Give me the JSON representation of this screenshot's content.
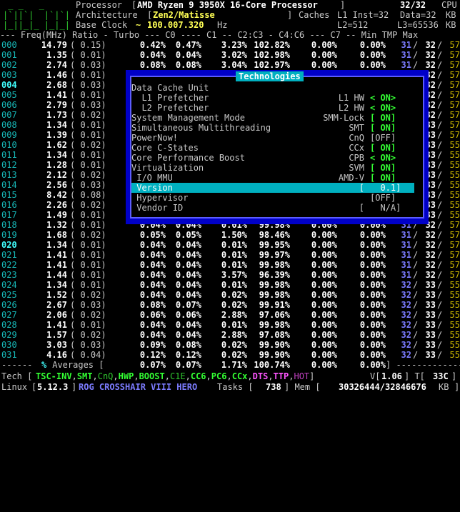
{
  "header": {
    "processor_label": "Processor",
    "processor_name": "AMD Ryzen 9 3950X 16-Core Processor",
    "cpu_count": "32/32",
    "cpu_suffix": "CPU",
    "architecture_label": "Architecture",
    "architecture_name": "Zen2/Matisse",
    "caches_label": "Caches",
    "l1_inst": "L1 Inst=32",
    "l1_data": "Data=32",
    "kb": "KB",
    "base_clock_label": "Base Clock",
    "base_clock_value": "100.007.320",
    "hz": "Hz",
    "l2": "L2=512",
    "l3": "L3=65536",
    "meter_line1": " _ _   _",
    "meter_line2": "|`||`|  |`|`|",
    "meter_line3": "|_||_|_ |_|_|"
  },
  "columns_header": "--- Freq(MHz) Ratio - Turbo --- C0 ---- C1 -- C2:C3 - C4:C6 --- C7 -- Min TMP Max",
  "rows": [
    {
      "cpu": "000",
      "freq": "14.79",
      "ratio": "( 0.15)",
      "turbo": "0.42%",
      "c0": "0.47%",
      "c1": "3.23%",
      "c3": "102.82%",
      "c6": "0.00%",
      "c7": "0.00%",
      "tmin": "31",
      "tcur": "32",
      "tmax": "57"
    },
    {
      "cpu": "001",
      "freq": "1.35",
      "ratio": "( 0.01)",
      "turbo": "0.04%",
      "c0": "0.04%",
      "c1": "3.02%",
      "c3": "102.98%",
      "c6": "0.00%",
      "c7": "0.00%",
      "tmin": "31",
      "tcur": "32",
      "tmax": "57"
    },
    {
      "cpu": "002",
      "freq": "2.74",
      "ratio": "( 0.03)",
      "turbo": "0.08%",
      "c0": "0.08%",
      "c1": "3.04%",
      "c3": "102.97%",
      "c6": "0.00%",
      "c7": "0.00%",
      "tmin": "31",
      "tcur": "32",
      "tmax": "57"
    },
    {
      "cpu": "003",
      "freq": "1.46",
      "ratio": "( 0.01)",
      "turbo": "",
      "c0": "",
      "c1": "",
      "c3": "",
      "c6": "",
      "c7": "",
      "tmin": "",
      "tcur": "32",
      "tmax": "57"
    },
    {
      "cpu": "004",
      "freq": "2.68",
      "ratio": "( 0.03)",
      "turbo": "",
      "c0": "",
      "c1": "",
      "c3": "",
      "c6": "",
      "c7": "",
      "tmin": "",
      "tcur": "32",
      "tmax": "57"
    },
    {
      "cpu": "005",
      "freq": "1.41",
      "ratio": "( 0.01)",
      "turbo": "",
      "c0": "",
      "c1": "",
      "c3": "",
      "c6": "",
      "c7": "",
      "tmin": "",
      "tcur": "32",
      "tmax": "57"
    },
    {
      "cpu": "006",
      "freq": "2.79",
      "ratio": "( 0.03)",
      "turbo": "",
      "c0": "",
      "c1": "",
      "c3": "",
      "c6": "",
      "c7": "",
      "tmin": "",
      "tcur": "32",
      "tmax": "57"
    },
    {
      "cpu": "007",
      "freq": "1.73",
      "ratio": "( 0.02)",
      "turbo": "",
      "c0": "",
      "c1": "",
      "c3": "",
      "c6": "",
      "c7": "",
      "tmin": "",
      "tcur": "32",
      "tmax": "57"
    },
    {
      "cpu": "008",
      "freq": "1.34",
      "ratio": "( 0.01)",
      "turbo": "",
      "c0": "",
      "c1": "",
      "c3": "",
      "c6": "",
      "c7": "",
      "tmin": "",
      "tcur": "33",
      "tmax": "57"
    },
    {
      "cpu": "009",
      "freq": "1.39",
      "ratio": "( 0.01)",
      "turbo": "",
      "c0": "",
      "c1": "",
      "c3": "",
      "c6": "",
      "c7": "",
      "tmin": "",
      "tcur": "33",
      "tmax": "57"
    },
    {
      "cpu": "010",
      "freq": "1.62",
      "ratio": "( 0.02)",
      "turbo": "",
      "c0": "",
      "c1": "",
      "c3": "",
      "c6": "",
      "c7": "",
      "tmin": "",
      "tcur": "33",
      "tmax": "55"
    },
    {
      "cpu": "011",
      "freq": "1.34",
      "ratio": "( 0.01)",
      "turbo": "",
      "c0": "",
      "c1": "",
      "c3": "",
      "c6": "",
      "c7": "",
      "tmin": "",
      "tcur": "33",
      "tmax": "55"
    },
    {
      "cpu": "012",
      "freq": "1.28",
      "ratio": "( 0.01)",
      "turbo": "",
      "c0": "",
      "c1": "",
      "c3": "",
      "c6": "",
      "c7": "",
      "tmin": "",
      "tcur": "33",
      "tmax": "55"
    },
    {
      "cpu": "013",
      "freq": "2.12",
      "ratio": "( 0.02)",
      "turbo": "",
      "c0": "",
      "c1": "",
      "c3": "",
      "c6": "",
      "c7": "",
      "tmin": "",
      "tcur": "33",
      "tmax": "55"
    },
    {
      "cpu": "014",
      "freq": "2.56",
      "ratio": "( 0.03)",
      "turbo": "",
      "c0": "",
      "c1": "",
      "c3": "",
      "c6": "",
      "c7": "",
      "tmin": "",
      "tcur": "33",
      "tmax": "55"
    },
    {
      "cpu": "015",
      "freq": "8.42",
      "ratio": "( 0.08)",
      "turbo": "",
      "c0": "",
      "c1": "",
      "c3": "",
      "c6": "",
      "c7": "",
      "tmin": "",
      "tcur": "33",
      "tmax": "55"
    },
    {
      "cpu": "016",
      "freq": "2.26",
      "ratio": "( 0.02)",
      "turbo": "",
      "c0": "",
      "c1": "",
      "c3": "",
      "c6": "",
      "c7": "",
      "tmin": "",
      "tcur": "33",
      "tmax": "55"
    },
    {
      "cpu": "017",
      "freq": "1.49",
      "ratio": "( 0.01)",
      "turbo": "",
      "c0": "",
      "c1": "",
      "c3": "",
      "c6": "",
      "c7": "",
      "tmin": "",
      "tcur": "33",
      "tmax": "55"
    },
    {
      "cpu": "018",
      "freq": "1.32",
      "ratio": "( 0.01)",
      "turbo": "0.04%",
      "c0": "0.04%",
      "c1": "0.01%",
      "c3": "99.98%",
      "c6": "0.00%",
      "c7": "0.00%",
      "tmin": "31",
      "tcur": "32",
      "tmax": "57"
    },
    {
      "cpu": "019",
      "freq": "1.68",
      "ratio": "( 0.02)",
      "turbo": "0.05%",
      "c0": "0.05%",
      "c1": "1.50%",
      "c3": "98.46%",
      "c6": "0.00%",
      "c7": "0.00%",
      "tmin": "31",
      "tcur": "32",
      "tmax": "57"
    },
    {
      "cpu": "020",
      "freq": "1.34",
      "ratio": "( 0.01)",
      "turbo": "0.04%",
      "c0": "0.04%",
      "c1": "0.01%",
      "c3": "99.95%",
      "c6": "0.00%",
      "c7": "0.00%",
      "tmin": "31",
      "tcur": "32",
      "tmax": "57"
    },
    {
      "cpu": "021",
      "freq": "1.41",
      "ratio": "( 0.01)",
      "turbo": "0.04%",
      "c0": "0.04%",
      "c1": "0.01%",
      "c3": "99.97%",
      "c6": "0.00%",
      "c7": "0.00%",
      "tmin": "31",
      "tcur": "32",
      "tmax": "57"
    },
    {
      "cpu": "022",
      "freq": "1.41",
      "ratio": "( 0.01)",
      "turbo": "0.04%",
      "c0": "0.04%",
      "c1": "0.01%",
      "c3": "99.98%",
      "c6": "0.00%",
      "c7": "0.00%",
      "tmin": "31",
      "tcur": "32",
      "tmax": "57"
    },
    {
      "cpu": "023",
      "freq": "1.44",
      "ratio": "( 0.01)",
      "turbo": "0.04%",
      "c0": "0.04%",
      "c1": "3.57%",
      "c3": "96.39%",
      "c6": "0.00%",
      "c7": "0.00%",
      "tmin": "31",
      "tcur": "32",
      "tmax": "57"
    },
    {
      "cpu": "024",
      "freq": "1.34",
      "ratio": "( 0.01)",
      "turbo": "0.04%",
      "c0": "0.04%",
      "c1": "0.01%",
      "c3": "99.98%",
      "c6": "0.00%",
      "c7": "0.00%",
      "tmin": "32",
      "tcur": "33",
      "tmax": "55"
    },
    {
      "cpu": "025",
      "freq": "1.52",
      "ratio": "( 0.02)",
      "turbo": "0.04%",
      "c0": "0.04%",
      "c1": "0.02%",
      "c3": "99.98%",
      "c6": "0.00%",
      "c7": "0.00%",
      "tmin": "32",
      "tcur": "33",
      "tmax": "55"
    },
    {
      "cpu": "026",
      "freq": "2.67",
      "ratio": "( 0.03)",
      "turbo": "0.08%",
      "c0": "0.07%",
      "c1": "0.02%",
      "c3": "99.91%",
      "c6": "0.00%",
      "c7": "0.00%",
      "tmin": "32",
      "tcur": "33",
      "tmax": "55"
    },
    {
      "cpu": "027",
      "freq": "2.06",
      "ratio": "( 0.02)",
      "turbo": "0.06%",
      "c0": "0.06%",
      "c1": "2.88%",
      "c3": "97.06%",
      "c6": "0.00%",
      "c7": "0.00%",
      "tmin": "32",
      "tcur": "33",
      "tmax": "55"
    },
    {
      "cpu": "028",
      "freq": "1.41",
      "ratio": "( 0.01)",
      "turbo": "0.04%",
      "c0": "0.04%",
      "c1": "0.01%",
      "c3": "99.98%",
      "c6": "0.00%",
      "c7": "0.00%",
      "tmin": "32",
      "tcur": "33",
      "tmax": "55"
    },
    {
      "cpu": "029",
      "freq": "1.57",
      "ratio": "( 0.02)",
      "turbo": "0.04%",
      "c0": "0.04%",
      "c1": "2.88%",
      "c3": "97.08%",
      "c6": "0.00%",
      "c7": "0.00%",
      "tmin": "32",
      "tcur": "33",
      "tmax": "55"
    },
    {
      "cpu": "030",
      "freq": "3.03",
      "ratio": "( 0.03)",
      "turbo": "0.09%",
      "c0": "0.08%",
      "c1": "0.02%",
      "c3": "99.90%",
      "c6": "0.00%",
      "c7": "0.00%",
      "tmin": "32",
      "tcur": "33",
      "tmax": "55"
    },
    {
      "cpu": "031",
      "freq": "4.16",
      "ratio": "( 0.04)",
      "turbo": "0.12%",
      "c0": "0.12%",
      "c1": "0.02%",
      "c3": "99.90%",
      "c6": "0.00%",
      "c7": "0.00%",
      "tmin": "32",
      "tcur": "33",
      "tmax": "55"
    }
  ],
  "averages": {
    "lead": "------ ",
    "pct": "%",
    "label": " Averages [",
    "turbo": "0.07%",
    "c0": "0.07%",
    "c1": "1.71%",
    "c3": "100.74%",
    "c6": "0.00%",
    "c7": "0.00%",
    "tail": "] --------------"
  },
  "tech_bar": {
    "prefix": "Tech [",
    "items": [
      "TSC-INV",
      "SMT",
      "CnQ",
      "HWP",
      "BOOST",
      "C1E",
      "CC6",
      "PC6",
      "CCx",
      "DTS",
      "TTP",
      "HOT"
    ],
    "suffix": "]",
    "v_label": "V[",
    "v_value": "1.06",
    "t_label": "] T[",
    "t_value": "33C",
    "t_end": "]"
  },
  "status_bar": {
    "os": "Linux",
    "kernel": "5.12.3",
    "board": "ROG CROSSHAIR VIII HERO",
    "tasks_label": "Tasks [",
    "tasks_value": "738",
    "mem_label": "] Mem [",
    "mem_value": "30326444/32846676",
    "mem_unit": "KB",
    "mem_end": "]"
  },
  "technologies_dialog": {
    "title": "Technologies",
    "items": [
      {
        "label": "Data Cache Unit",
        "code": "",
        "state": ""
      },
      {
        "label": "  L1 Prefetcher",
        "code": "L1 HW",
        "state": "< ON>"
      },
      {
        "label": "  L2 Prefetcher",
        "code": "L2 HW",
        "state": "< ON>"
      },
      {
        "label": "System Management Mode",
        "code": "SMM-Lock",
        "state": "[ ON]"
      },
      {
        "label": "Simultaneous Multithreading",
        "code": "SMT",
        "state": "[ ON]"
      },
      {
        "label": "PowerNow!",
        "code": "CnQ",
        "state": "[OFF]"
      },
      {
        "label": "Core C-States",
        "code": "CCx",
        "state": "[ ON]"
      },
      {
        "label": "Core Performance Boost",
        "code": "CPB",
        "state": "< ON>"
      },
      {
        "label": "Virtualization",
        "code": "SVM",
        "state": "[ ON]"
      },
      {
        "label": " I/O MMU",
        "code": "AMD-V",
        "state": "[ ON]"
      },
      {
        "label": " Version",
        "code": "[",
        "state": "  0.1]"
      },
      {
        "label": " Hypervisor",
        "code": "",
        "state": "[OFF]"
      },
      {
        "label": " Vendor ID",
        "code": "[",
        "state": "  N/A]"
      }
    ]
  }
}
